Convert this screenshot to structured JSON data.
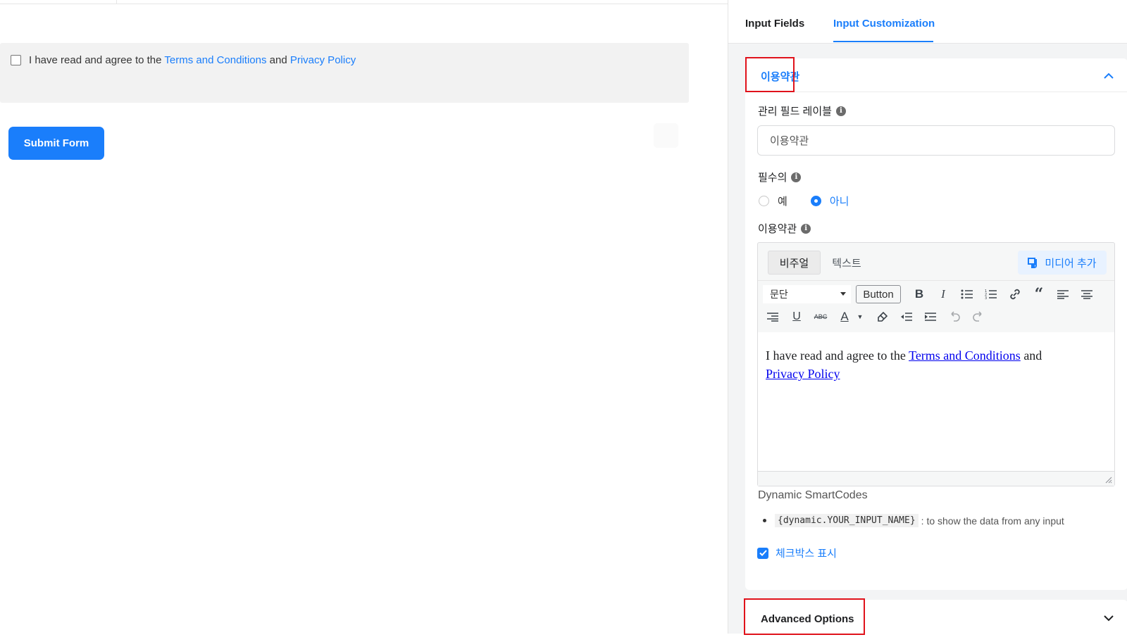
{
  "canvas": {
    "field": {
      "prefix": "I have read and agree to the",
      "terms_link": "Terms and Conditions",
      "and": "and",
      "privacy_link": "Privacy Policy"
    },
    "submit_label": "Submit Form"
  },
  "panel": {
    "tabs": [
      {
        "label": "Input Fields",
        "active": false
      },
      {
        "label": "Input Customization",
        "active": true
      }
    ],
    "section_title": "이용약관",
    "admin_label": {
      "label": "관리 필드 레이블",
      "value": "이용약관"
    },
    "required": {
      "label": "필수의",
      "options": [
        {
          "label": "예",
          "selected": false
        },
        {
          "label": "아니",
          "selected": true
        }
      ]
    },
    "terms_label": "이용약관",
    "editor": {
      "tab_visual": "비주얼",
      "tab_text": "텍스트",
      "media_button": "미디어 추가",
      "format_select": "문단",
      "button_label": "Button",
      "content_prefix": "I have read and agree to the",
      "content_terms": "Terms and Conditions",
      "content_and": "and",
      "content_privacy": "Privacy Policy"
    },
    "smartcodes": {
      "title": "Dynamic SmartCodes",
      "code": "{dynamic.YOUR_INPUT_NAME}",
      "description": ": to show the data from any input"
    },
    "show_checkbox": {
      "label": "체크박스 표시",
      "checked": true
    },
    "advanced_title": "Advanced Options"
  },
  "colors": {
    "accent": "#1a7efb",
    "highlight_box": "#e0121b"
  }
}
